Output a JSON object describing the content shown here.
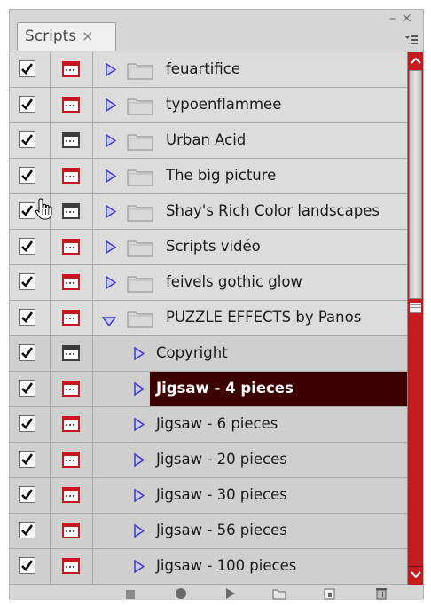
{
  "panel": {
    "tab_label": "Scripts",
    "tab_close": "×",
    "minimize_glyph": "–",
    "close_glyph": "×"
  },
  "colors": {
    "accent_red": "#c41c1c",
    "selection": "#3d0000",
    "dialog_red": "#c8161d",
    "triangle_blue": "#3535c8"
  },
  "rows": [
    {
      "label": "feuartifice",
      "level": 0,
      "expanded": false,
      "checked": true,
      "dialog": "red",
      "icons": [
        "checkbox-icon",
        "dialog-toggle-icon",
        "expand-triangle-icon",
        "folder-icon"
      ]
    },
    {
      "label": "typoenflammee",
      "level": 0,
      "expanded": false,
      "checked": true,
      "dialog": "red"
    },
    {
      "label": "Urban Acid",
      "level": 0,
      "expanded": false,
      "checked": true,
      "dialog": "black"
    },
    {
      "label": "The big picture",
      "level": 0,
      "expanded": false,
      "checked": true,
      "dialog": "red"
    },
    {
      "label": "Shay's Rich Color landscapes",
      "level": 0,
      "expanded": false,
      "checked": true,
      "dialog": "black"
    },
    {
      "label": "Scripts vidéo",
      "level": 0,
      "expanded": false,
      "checked": true,
      "dialog": "red"
    },
    {
      "label": "feivels gothic glow",
      "level": 0,
      "expanded": false,
      "checked": true,
      "dialog": "red"
    },
    {
      "label": "PUZZLE EFFECTS by Panos",
      "level": 0,
      "expanded": true,
      "checked": true,
      "dialog": "red"
    },
    {
      "label": "Copyright",
      "level": 1,
      "checked": true,
      "dialog": "black"
    },
    {
      "label": "Jigsaw - 4 pieces",
      "level": 1,
      "checked": true,
      "dialog": "red",
      "selected": true
    },
    {
      "label": "Jigsaw - 6 pieces",
      "level": 1,
      "checked": true,
      "dialog": "red"
    },
    {
      "label": "Jigsaw - 20 pieces",
      "level": 1,
      "checked": true,
      "dialog": "red"
    },
    {
      "label": "Jigsaw - 30 pieces",
      "level": 1,
      "checked": true,
      "dialog": "red"
    },
    {
      "label": "Jigsaw - 56 pieces",
      "level": 1,
      "checked": true,
      "dialog": "red"
    },
    {
      "label": "Jigsaw - 100 pieces",
      "level": 1,
      "checked": true,
      "dialog": "red"
    }
  ],
  "scrollbar": {
    "up_glyph": "⌃",
    "down_glyph": "⌄"
  },
  "bottom_toolbar": [
    "stop-icon",
    "record-icon",
    "play-icon",
    "new-set-icon",
    "new-action-icon",
    "delete-icon"
  ]
}
